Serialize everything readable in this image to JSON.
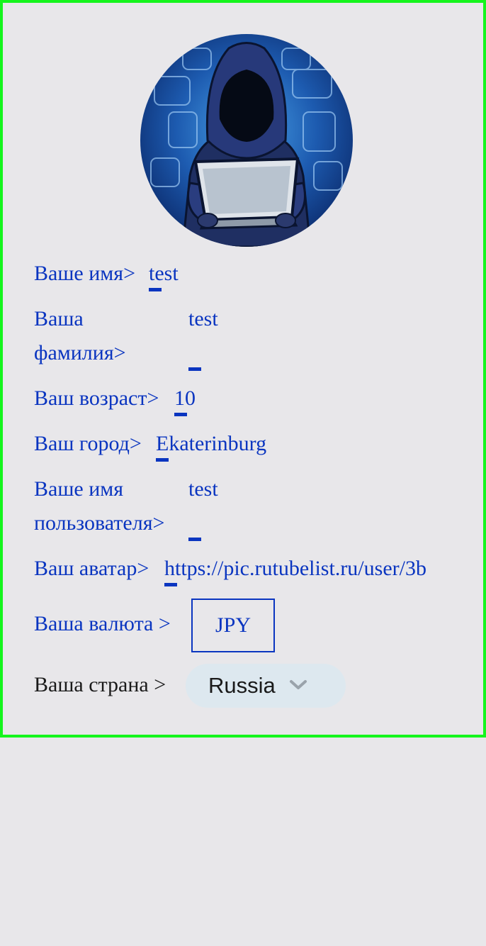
{
  "profile": {
    "avatar_icon": "hooded-hacker-avatar",
    "fields": {
      "first_name": {
        "label": "Ваше имя>",
        "value": "test"
      },
      "last_name": {
        "label": "Ваша фамилия>",
        "value": "test"
      },
      "age": {
        "label": "Ваш возраст>",
        "value": "10"
      },
      "city": {
        "label": "Ваш город>",
        "value": "Ekaterinburg"
      },
      "username": {
        "label": "Ваше имя пользователя>",
        "value": "test"
      },
      "avatar_url": {
        "label": "Ваш аватар>",
        "value": "https://pic.rutubelist.ru/user/3b"
      }
    },
    "currency": {
      "label": "Ваша валюта >",
      "value": "JPY"
    },
    "country": {
      "label": "Ваша страна >",
      "value": "Russia",
      "icon": "chevron-down-icon"
    }
  },
  "colors": {
    "background": "#e8e7ea",
    "accent": "#0a35c0",
    "frame": "#15f51d",
    "select_bg": "#dde8ef"
  }
}
